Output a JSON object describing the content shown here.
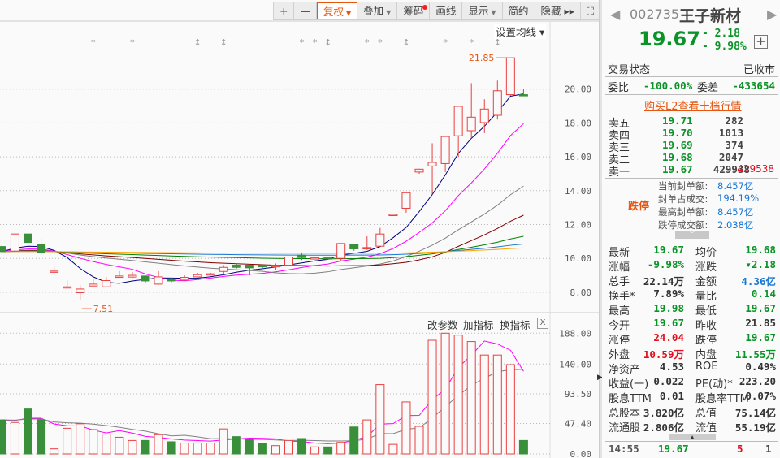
{
  "toolbar": {
    "items": [
      {
        "label": "+"
      },
      {
        "label": "—"
      },
      {
        "label": "复权",
        "active": true,
        "caret": true
      },
      {
        "label": "叠加",
        "caret": true
      },
      {
        "label": "筹码",
        "dot": true
      },
      {
        "label": "画线"
      },
      {
        "label": "显示",
        "caret": true
      },
      {
        "label": "简约"
      },
      {
        "label": "隐藏 ▸▸"
      },
      {
        "label": "⛶"
      }
    ]
  },
  "chart": {
    "set_ma_label": "设置均线 ▾",
    "high_label": "21.85",
    "low_label": "7.51",
    "price_ticks": [
      "20.00",
      "18.00",
      "16.00",
      "14.00",
      "12.00",
      "10.00",
      "8.00"
    ],
    "vol_ticks": [
      "188.00",
      "140.00",
      "93.50",
      "47.40",
      "0.00"
    ],
    "indicator_buttons": [
      "改参数",
      "加指标",
      "换指标"
    ],
    "close_label": "X",
    "colors": {
      "up": "#e84040",
      "down": "#3a8f3a",
      "ma": [
        "#000080",
        "#ff00ff",
        "#808080",
        "#800000",
        "#008000",
        "#1a76d2",
        "#ffa500"
      ]
    },
    "markers": [
      {
        "i": 7,
        "t": "*"
      },
      {
        "i": 10,
        "t": "*"
      },
      {
        "i": 15,
        "t": "↕"
      },
      {
        "i": 17,
        "t": "↕"
      },
      {
        "i": 23,
        "t": "*"
      },
      {
        "i": 24,
        "t": "*"
      },
      {
        "i": 25,
        "t": "↕"
      },
      {
        "i": 28,
        "t": "*"
      },
      {
        "i": 29,
        "t": "*"
      },
      {
        "i": 31,
        "t": "↕"
      },
      {
        "i": 34,
        "t": "*"
      },
      {
        "i": 36,
        "t": "*"
      },
      {
        "i": 38,
        "t": "↕"
      }
    ]
  },
  "chart_data": {
    "type": "candlestick",
    "ohlc": [
      [
        10.7,
        10.8,
        10.3,
        10.4
      ],
      [
        10.43,
        11.44,
        10.4,
        11.44
      ],
      [
        11.44,
        11.5,
        10.9,
        10.94
      ],
      [
        10.83,
        11.2,
        10.2,
        10.32
      ],
      [
        9.25,
        9.5,
        9.2,
        9.25
      ],
      [
        8.32,
        8.72,
        8.32,
        8.32
      ],
      [
        7.97,
        8.4,
        7.51,
        8.19
      ],
      [
        8.37,
        8.8,
        8.35,
        8.48
      ],
      [
        8.32,
        8.9,
        8.3,
        8.69
      ],
      [
        8.88,
        9.25,
        8.85,
        8.96
      ],
      [
        8.9,
        9.2,
        8.85,
        9.0
      ],
      [
        8.96,
        9.0,
        8.55,
        8.67
      ],
      [
        8.48,
        9.25,
        8.45,
        8.91
      ],
      [
        8.8,
        8.85,
        8.6,
        8.67
      ],
      [
        8.72,
        9.0,
        8.7,
        8.88
      ],
      [
        8.91,
        9.15,
        8.88,
        9.04
      ],
      [
        9.04,
        9.15,
        9.0,
        9.09
      ],
      [
        9.23,
        9.6,
        9.1,
        9.47
      ],
      [
        9.6,
        9.7,
        9.4,
        9.47
      ],
      [
        9.6,
        9.62,
        9.0,
        9.44
      ],
      [
        9.6,
        9.62,
        9.45,
        9.5
      ],
      [
        9.5,
        9.7,
        9.3,
        9.6
      ],
      [
        9.6,
        10.1,
        9.55,
        10.08
      ],
      [
        10.19,
        10.35,
        9.9,
        10.05
      ],
      [
        10.03,
        10.1,
        10.0,
        10.03
      ],
      [
        10.03,
        10.05,
        9.95,
        9.97
      ],
      [
        10.0,
        10.9,
        9.85,
        10.88
      ],
      [
        10.83,
        10.85,
        10.45,
        10.56
      ],
      [
        10.56,
        11.3,
        10.5,
        10.64
      ],
      [
        10.72,
        11.8,
        10.7,
        11.44
      ],
      [
        12.6,
        12.6,
        12.6,
        12.6
      ],
      [
        12.96,
        13.9,
        12.7,
        13.88
      ],
      [
        15.1,
        15.3,
        15.0,
        15.27
      ],
      [
        15.46,
        16.8,
        13.8,
        15.67
      ],
      [
        15.6,
        17.2,
        15.1,
        17.2
      ],
      [
        17.24,
        18.98,
        16.0,
        18.98
      ],
      [
        17.54,
        20.35,
        17.1,
        18.34
      ],
      [
        18.02,
        19.4,
        17.4,
        18.82
      ],
      [
        18.45,
        20.5,
        18.2,
        19.9
      ],
      [
        19.67,
        21.85,
        19.6,
        21.85
      ],
      [
        19.67,
        19.98,
        19.67,
        19.67
      ]
    ],
    "volume": [
      53,
      49,
      70,
      53,
      8,
      40,
      47,
      38,
      31,
      26,
      21,
      21,
      30,
      19,
      17,
      17,
      17,
      39,
      27,
      23,
      16,
      13,
      21,
      24,
      11,
      11,
      18,
      42,
      53,
      108,
      15,
      81,
      43,
      177,
      188,
      185,
      175,
      154,
      154,
      139,
      21
    ],
    "ma_periods": [
      5,
      10,
      20,
      30,
      60,
      120,
      250
    ],
    "vol_ma_periods": [
      5,
      10
    ],
    "ylim": [
      7.2,
      22.2
    ],
    "vol_ylim": [
      0,
      188
    ]
  },
  "quote": {
    "code": "002735",
    "name": "王子新材",
    "price": "19.67",
    "change": "- 2.18",
    "change_pct": "- 9.98%",
    "plus": "+",
    "status_label": "交易状态",
    "status": "已收市",
    "weibi_label": "委比",
    "weibi": "-100.00%",
    "weicha_label": "委差",
    "weicha": "-433654",
    "l2_link": "购买L2查看十档行情",
    "asks": [
      {
        "label": "卖五",
        "price": "19.71",
        "vol": "282"
      },
      {
        "label": "卖四",
        "price": "19.70",
        "vol": "1013"
      },
      {
        "label": "卖三",
        "price": "19.69",
        "vol": "374"
      },
      {
        "label": "卖二",
        "price": "19.68",
        "vol": "2047"
      },
      {
        "label": "卖一",
        "price": "19.67",
        "vol": "429938",
        "delta": "-429538"
      }
    ],
    "limit_label": "跌停",
    "limit_info": [
      {
        "label": "当前封单额:",
        "value": "8.457亿"
      },
      {
        "label": "封单占成交:",
        "value": "194.19%"
      },
      {
        "label": "最高封单额:",
        "value": "8.457亿"
      },
      {
        "label": "跌停成交额:",
        "value": "2.038亿"
      }
    ],
    "stats": [
      [
        "最新",
        "19.67",
        "g",
        "均价",
        "19.68",
        "g"
      ],
      [
        "涨幅",
        "-9.98%",
        "g",
        "涨跌",
        "▾2.18",
        "g"
      ],
      [
        "总手",
        "22.14万",
        "k",
        "金额",
        "4.36亿",
        "b"
      ],
      [
        "换手*",
        "7.89%",
        "k",
        "量比",
        "0.14",
        "g"
      ],
      [
        "最高",
        "19.98",
        "g",
        "最低",
        "19.67",
        "g"
      ],
      [
        "今开",
        "19.67",
        "g",
        "昨收",
        "21.85",
        "k"
      ],
      [
        "涨停",
        "24.04",
        "r",
        "跌停",
        "19.67",
        "g"
      ],
      [
        "外盘",
        "10.59万",
        "r",
        "内盘",
        "11.55万",
        "g"
      ],
      [
        "净资产",
        "4.53",
        "k",
        "ROE",
        "0.49%",
        "k"
      ],
      [
        "收益(一)",
        "0.022",
        "k",
        "PE(动)*",
        "223.20",
        "k"
      ],
      [
        "股息TTM",
        "0.01",
        "k",
        "股息率TTM",
        "0.07%",
        "k"
      ],
      [
        "总股本",
        "3.820亿",
        "k",
        "总值",
        "75.14亿",
        "k"
      ],
      [
        "流通股",
        "2.806亿",
        "k",
        "流值",
        "55.19亿",
        "k"
      ]
    ],
    "tick": {
      "time": "14:55",
      "price": "19.67",
      "vol": "5",
      "count": "1"
    }
  }
}
